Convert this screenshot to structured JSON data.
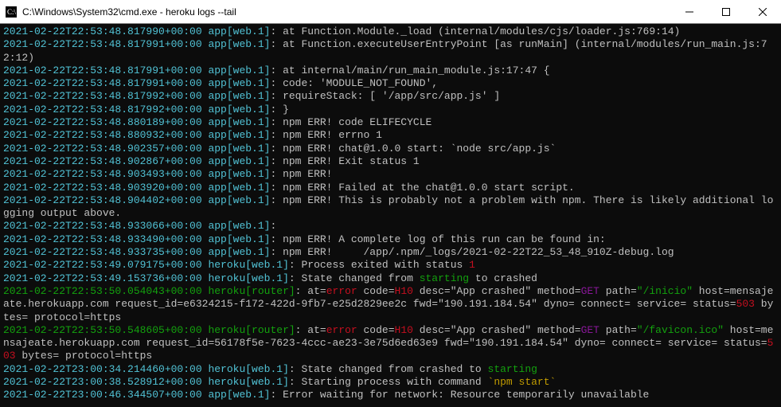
{
  "window": {
    "title": "C:\\Windows\\System32\\cmd.exe - heroku  logs --tail"
  },
  "logs": {
    "l01_ts": "2021-02-22T22:53:48.817990+00:00",
    "l01_src": "app[web.1]",
    "l01_msg": ": at Function.Module._load (internal/modules/cjs/loader.js:769:14)",
    "l02_ts": "2021-02-22T22:53:48.817991+00:00",
    "l02_src": "app[web.1]",
    "l02_msg": ": at Function.executeUserEntryPoint [as runMain] (internal/modules/run_main.js:72:12)",
    "l03_ts": "2021-02-22T22:53:48.817991+00:00",
    "l03_src": "app[web.1]",
    "l03_msg": ": at internal/main/run_main_module.js:17:47 {",
    "l04_ts": "2021-02-22T22:53:48.817991+00:00",
    "l04_src": "app[web.1]",
    "l04_msg": ": code: 'MODULE_NOT_FOUND',",
    "l05_ts": "2021-02-22T22:53:48.817992+00:00",
    "l05_src": "app[web.1]",
    "l05_msg": ": requireStack: [ '/app/src/app.js' ]",
    "l06_ts": "2021-02-22T22:53:48.817992+00:00",
    "l06_src": "app[web.1]",
    "l06_msg": ": }",
    "l07_ts": "2021-02-22T22:53:48.880189+00:00",
    "l07_src": "app[web.1]",
    "l07_msg": ": npm ERR! code ELIFECYCLE",
    "l08_ts": "2021-02-22T22:53:48.880932+00:00",
    "l08_src": "app[web.1]",
    "l08_msg": ": npm ERR! errno 1",
    "l09_ts": "2021-02-22T22:53:48.902357+00:00",
    "l09_src": "app[web.1]",
    "l09_msg": ": npm ERR! chat@1.0.0 start: `node src/app.js`",
    "l10_ts": "2021-02-22T22:53:48.902867+00:00",
    "l10_src": "app[web.1]",
    "l10_msg": ": npm ERR! Exit status 1",
    "l11_ts": "2021-02-22T22:53:48.903493+00:00",
    "l11_src": "app[web.1]",
    "l11_msg": ": npm ERR!",
    "l12_ts": "2021-02-22T22:53:48.903920+00:00",
    "l12_src": "app[web.1]",
    "l12_msg": ": npm ERR! Failed at the chat@1.0.0 start script.",
    "l13_ts": "2021-02-22T22:53:48.904402+00:00",
    "l13_src": "app[web.1]",
    "l13_msg": ": npm ERR! This is probably not a problem with npm. There is likely additional logging output above.",
    "l14_ts": "2021-02-22T22:53:48.933066+00:00",
    "l14_src": "app[web.1]",
    "l14_msg": ":",
    "l15_ts": "2021-02-22T22:53:48.933490+00:00",
    "l15_src": "app[web.1]",
    "l15_msg": ": npm ERR! A complete log of this run can be found in:",
    "l16_ts": "2021-02-22T22:53:48.933735+00:00",
    "l16_src": "app[web.1]",
    "l16_msg": ": npm ERR!     /app/.npm/_logs/2021-02-22T22_53_48_910Z-debug.log",
    "l17_ts": "2021-02-22T22:53:49.079175+00:00",
    "l17_src": "heroku[web.1]",
    "l17_msg_a": ": Process exited with status ",
    "l17_msg_b": "1",
    "l18_ts": "2021-02-22T22:53:49.153736+00:00",
    "l18_src": "heroku[web.1]",
    "l18_msg_a": ": State changed from ",
    "l18_msg_b": "starting",
    "l18_msg_c": " to crashed",
    "l19_ts": "2021-02-22T22:53:50.054043+00:00",
    "l19_src": "heroku[router]",
    "l19_a": ": at=",
    "l19_b": "error",
    "l19_c": " code=",
    "l19_d": "H10",
    "l19_e": " desc=\"App crashed\" method=",
    "l19_f": "GET",
    "l19_g": " path=",
    "l19_h": "\"/inicio\"",
    "l19_i": " host=mensajeate.herokuapp.com request_id=e6324215-f172-422d-9fb7-e25d2829ee2c fwd=\"190.191.184.54\" dyno= connect= service= status=",
    "l19_j": "503",
    "l19_k": " bytes= protocol=https",
    "l20_ts": "2021-02-22T22:53:50.548605+00:00",
    "l20_src": "heroku[router]",
    "l20_a": ": at=",
    "l20_b": "error",
    "l20_c": " code=",
    "l20_d": "H10",
    "l20_e": " desc=\"App crashed\" method=",
    "l20_f": "GET",
    "l20_g": " path=",
    "l20_h": "\"/favicon.ico\"",
    "l20_i": " host=mensajeate.herokuapp.com request_id=56178f5e-7623-4ccc-ae23-3e75d6ed63e9 fwd=\"190.191.184.54\" dyno= connect= service= status=",
    "l20_j": "503",
    "l20_k": " bytes= protocol=https",
    "l21_ts": "2021-02-22T23:00:34.214460+00:00",
    "l21_src": "heroku[web.1]",
    "l21_msg_a": ": State changed from crashed to ",
    "l21_msg_b": "starting",
    "l22_ts": "2021-02-22T23:00:38.528912+00:00",
    "l22_src": "heroku[web.1]",
    "l22_msg_a": ": Starting process with command ",
    "l22_msg_b": "`npm start`",
    "l23_ts": "2021-02-22T23:00:46.344507+00:00",
    "l23_src": "app[web.1]",
    "l23_msg": ": Error waiting for network: Resource temporarily unavailable"
  }
}
